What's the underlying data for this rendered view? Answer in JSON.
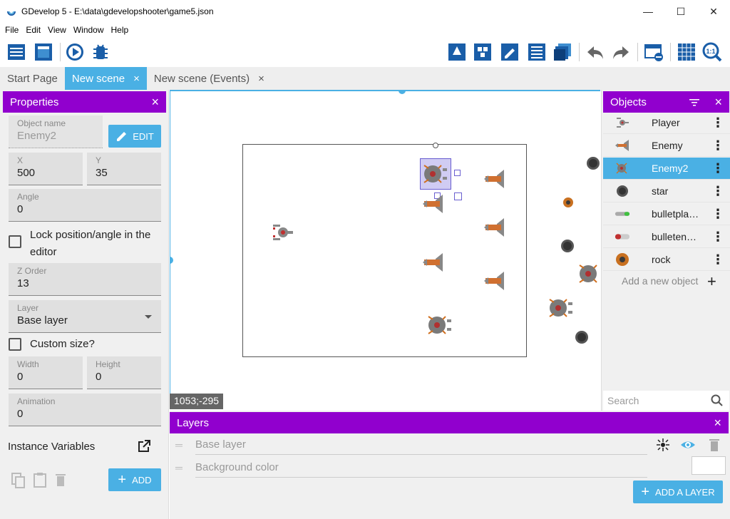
{
  "window": {
    "title": "GDevelop 5 - E:\\data\\gdevelopshooter\\game5.json",
    "minimize": "—",
    "maximize": "☐",
    "close": "✕"
  },
  "menu": [
    "File",
    "Edit",
    "View",
    "Window",
    "Help"
  ],
  "tabs": [
    {
      "label": "Start Page",
      "closable": false
    },
    {
      "label": "New scene",
      "closable": true,
      "close": "×"
    },
    {
      "label": "New scene (Events)",
      "closable": true,
      "close": "×"
    }
  ],
  "properties": {
    "title": "Properties",
    "close": "×",
    "object_name_label": "Object name",
    "object_name_value": "Enemy2",
    "edit_button": "EDIT",
    "x_label": "X",
    "x_value": "500",
    "y_label": "Y",
    "y_value": "35",
    "angle_label": "Angle",
    "angle_value": "0",
    "lock_label": "Lock position/angle in the editor",
    "zorder_label": "Z Order",
    "zorder_value": "13",
    "layer_label": "Layer",
    "layer_value": "Base layer",
    "custom_size_label": "Custom size?",
    "width_label": "Width",
    "width_value": "0",
    "height_label": "Height",
    "height_value": "0",
    "animation_label": "Animation",
    "animation_value": "0",
    "instance_variables_label": "Instance Variables",
    "add_button": "ADD"
  },
  "canvas": {
    "coords": "1053;-295"
  },
  "objects": {
    "title": "Objects",
    "close": "×",
    "items": [
      {
        "name": "Player",
        "icon": "player-ship-icon",
        "selected": false
      },
      {
        "name": "Enemy",
        "icon": "enemy-ship-icon",
        "selected": false
      },
      {
        "name": "Enemy2",
        "icon": "enemy2-mine-icon",
        "selected": true
      },
      {
        "name": "star",
        "icon": "star-icon",
        "selected": false
      },
      {
        "name": "bulletpla…",
        "icon": "bullet-player-icon",
        "selected": false
      },
      {
        "name": "bulleten…",
        "icon": "bullet-enemy-icon",
        "selected": false
      },
      {
        "name": "rock",
        "icon": "rock-icon",
        "selected": false
      }
    ],
    "menu_glyph": "⋮",
    "add_new": "Add a new object",
    "add_plus": "+",
    "search_placeholder": "Search"
  },
  "layers": {
    "title": "Layers",
    "close": "×",
    "base_layer": "Base layer",
    "background_color": "Background color",
    "add_layer_button": "ADD A LAYER"
  },
  "colors": {
    "accent": "#4ab0e4",
    "panel_header": "#9100ce",
    "toolbar_blue": "#1a5ea8"
  }
}
